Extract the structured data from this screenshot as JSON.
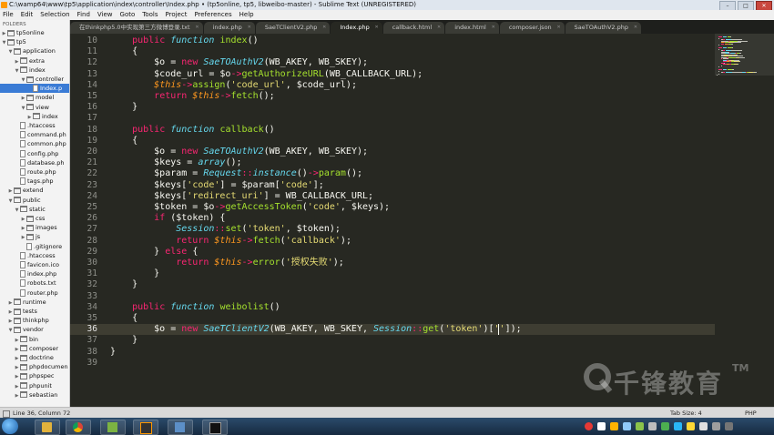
{
  "window": {
    "title": "C:\\wamp64\\www\\tp5\\application\\index\\controller\\Index.php • (tp5online, tp5, libweibo-master) - Sublime Text (UNREGISTERED)"
  },
  "menu": [
    "File",
    "Edit",
    "Selection",
    "Find",
    "View",
    "Goto",
    "Tools",
    "Project",
    "Preferences",
    "Help"
  ],
  "sidebar": {
    "header": "FOLDERS",
    "items": [
      {
        "label": "tp5online",
        "depth": 0,
        "type": "folder",
        "open": false
      },
      {
        "label": "tp5",
        "depth": 0,
        "type": "folder",
        "open": true
      },
      {
        "label": "application",
        "depth": 1,
        "type": "folder",
        "open": true
      },
      {
        "label": "extra",
        "depth": 2,
        "type": "folder",
        "open": false
      },
      {
        "label": "index",
        "depth": 2,
        "type": "folder",
        "open": true
      },
      {
        "label": "controller",
        "depth": 3,
        "type": "folder",
        "open": true
      },
      {
        "label": "Index.p",
        "depth": 4,
        "type": "file",
        "selected": true
      },
      {
        "label": "model",
        "depth": 3,
        "type": "folder",
        "open": false
      },
      {
        "label": "view",
        "depth": 3,
        "type": "folder",
        "open": true
      },
      {
        "label": "index",
        "depth": 4,
        "type": "folder",
        "open": false
      },
      {
        "label": ".htaccess",
        "depth": 2,
        "type": "file"
      },
      {
        "label": "command.ph",
        "depth": 2,
        "type": "file"
      },
      {
        "label": "common.php",
        "depth": 2,
        "type": "file"
      },
      {
        "label": "config.php",
        "depth": 2,
        "type": "file"
      },
      {
        "label": "database.ph",
        "depth": 2,
        "type": "file"
      },
      {
        "label": "route.php",
        "depth": 2,
        "type": "file"
      },
      {
        "label": "tags.php",
        "depth": 2,
        "type": "file"
      },
      {
        "label": "extend",
        "depth": 1,
        "type": "folder",
        "open": false
      },
      {
        "label": "public",
        "depth": 1,
        "type": "folder",
        "open": true
      },
      {
        "label": "static",
        "depth": 2,
        "type": "folder",
        "open": true
      },
      {
        "label": "css",
        "depth": 3,
        "type": "folder",
        "open": false
      },
      {
        "label": "images",
        "depth": 3,
        "type": "folder",
        "open": false
      },
      {
        "label": "js",
        "depth": 3,
        "type": "folder",
        "open": false
      },
      {
        "label": ".gitignore",
        "depth": 3,
        "type": "file"
      },
      {
        "label": ".htaccess",
        "depth": 2,
        "type": "file"
      },
      {
        "label": "favicon.ico",
        "depth": 2,
        "type": "file"
      },
      {
        "label": "index.php",
        "depth": 2,
        "type": "file"
      },
      {
        "label": "robots.txt",
        "depth": 2,
        "type": "file"
      },
      {
        "label": "router.php",
        "depth": 2,
        "type": "file"
      },
      {
        "label": "runtime",
        "depth": 1,
        "type": "folder",
        "open": false
      },
      {
        "label": "tests",
        "depth": 1,
        "type": "folder",
        "open": false
      },
      {
        "label": "thinkphp",
        "depth": 1,
        "type": "folder",
        "open": false
      },
      {
        "label": "vendor",
        "depth": 1,
        "type": "folder",
        "open": true
      },
      {
        "label": "bin",
        "depth": 2,
        "type": "folder",
        "open": false
      },
      {
        "label": "composer",
        "depth": 2,
        "type": "folder",
        "open": false
      },
      {
        "label": "doctrine",
        "depth": 2,
        "type": "folder",
        "open": false
      },
      {
        "label": "phpdocumen",
        "depth": 2,
        "type": "folder",
        "open": false
      },
      {
        "label": "phpspec",
        "depth": 2,
        "type": "folder",
        "open": false
      },
      {
        "label": "phpunit",
        "depth": 2,
        "type": "folder",
        "open": false
      },
      {
        "label": "sebastian",
        "depth": 2,
        "type": "folder",
        "open": false
      }
    ]
  },
  "tabs": [
    {
      "label": "在thinkphp5.0中实现第三方微博登录.txt",
      "active": false
    },
    {
      "label": "index.php",
      "active": false
    },
    {
      "label": "SaeTClientV2.php",
      "active": false
    },
    {
      "label": "Index.php",
      "active": true
    },
    {
      "label": "callback.html",
      "active": false
    },
    {
      "label": "index.html",
      "active": false
    },
    {
      "label": "composer.json",
      "active": false
    },
    {
      "label": "SaeTOAuthV2.php",
      "active": false
    }
  ],
  "editor": {
    "current_line": 36,
    "lines": [
      {
        "n": "10",
        "t": [
          [
            "    ",
            ""
          ],
          [
            "public",
            "kw"
          ],
          [
            " ",
            ""
          ],
          [
            "function",
            "sf"
          ],
          [
            " ",
            ""
          ],
          [
            "index",
            "fn"
          ],
          [
            "()",
            ""
          ]
        ]
      },
      {
        "n": "11",
        "t": [
          [
            "    {",
            ""
          ]
        ]
      },
      {
        "n": "12",
        "t": [
          [
            "        $o = ",
            ""
          ],
          [
            "new",
            "kw"
          ],
          [
            " ",
            ""
          ],
          [
            "SaeTOAuthV2",
            "cls"
          ],
          [
            "(WB_AKEY, WB_SKEY);",
            ""
          ]
        ]
      },
      {
        "n": "13",
        "t": [
          [
            "        $code_url = $o",
            ""
          ],
          [
            "->",
            "op"
          ],
          [
            "getAuthorizeURL",
            "fn"
          ],
          [
            "(WB_CALLBACK_URL);",
            ""
          ]
        ]
      },
      {
        "n": "14",
        "t": [
          [
            "        ",
            ""
          ],
          [
            "$this",
            "th"
          ],
          [
            "->",
            "op"
          ],
          [
            "assign",
            "fn"
          ],
          [
            "(",
            ""
          ],
          [
            "'code_url'",
            "st"
          ],
          [
            ", $code_url);",
            ""
          ]
        ]
      },
      {
        "n": "15",
        "t": [
          [
            "        ",
            ""
          ],
          [
            "return",
            "kw"
          ],
          [
            " ",
            ""
          ],
          [
            "$this",
            "th"
          ],
          [
            "->",
            "op"
          ],
          [
            "fetch",
            "fn"
          ],
          [
            "();",
            ""
          ]
        ]
      },
      {
        "n": "16",
        "t": [
          [
            "    }",
            ""
          ]
        ]
      },
      {
        "n": "17",
        "t": [
          [
            "",
            ""
          ]
        ]
      },
      {
        "n": "18",
        "t": [
          [
            "    ",
            ""
          ],
          [
            "public",
            "kw"
          ],
          [
            " ",
            ""
          ],
          [
            "function",
            "sf"
          ],
          [
            " ",
            ""
          ],
          [
            "callback",
            "fn"
          ],
          [
            "()",
            ""
          ]
        ]
      },
      {
        "n": "19",
        "t": [
          [
            "    {",
            ""
          ]
        ]
      },
      {
        "n": "20",
        "t": [
          [
            "        $o = ",
            ""
          ],
          [
            "new",
            "kw"
          ],
          [
            " ",
            ""
          ],
          [
            "SaeTOAuthV2",
            "cls"
          ],
          [
            "(WB_AKEY, WB_SKEY);",
            ""
          ]
        ]
      },
      {
        "n": "21",
        "t": [
          [
            "        $keys = ",
            ""
          ],
          [
            "array",
            "sf"
          ],
          [
            "();",
            ""
          ]
        ]
      },
      {
        "n": "22",
        "t": [
          [
            "        $param = ",
            ""
          ],
          [
            "Request",
            "cls"
          ],
          [
            "::",
            "op"
          ],
          [
            "instance",
            "sf"
          ],
          [
            "()",
            ""
          ],
          [
            "->",
            "op"
          ],
          [
            "param",
            "fn"
          ],
          [
            "();",
            ""
          ]
        ]
      },
      {
        "n": "23",
        "t": [
          [
            "        $keys[",
            ""
          ],
          [
            "'code'",
            "st"
          ],
          [
            "] = $param[",
            ""
          ],
          [
            "'code'",
            "st"
          ],
          [
            "];",
            ""
          ]
        ]
      },
      {
        "n": "24",
        "t": [
          [
            "        $keys[",
            ""
          ],
          [
            "'redirect_uri'",
            "st"
          ],
          [
            "] = WB_CALLBACK_URL;",
            ""
          ]
        ]
      },
      {
        "n": "25",
        "t": [
          [
            "        $token = $o",
            ""
          ],
          [
            "->",
            "op"
          ],
          [
            "getAccessToken",
            "fn"
          ],
          [
            "(",
            ""
          ],
          [
            "'code'",
            "st"
          ],
          [
            ", $keys);",
            ""
          ]
        ]
      },
      {
        "n": "26",
        "t": [
          [
            "        ",
            ""
          ],
          [
            "if",
            "kw"
          ],
          [
            " ($token) {",
            ""
          ]
        ]
      },
      {
        "n": "27",
        "t": [
          [
            "            ",
            ""
          ],
          [
            "Session",
            "cls"
          ],
          [
            "::",
            "op"
          ],
          [
            "set",
            "fn"
          ],
          [
            "(",
            ""
          ],
          [
            "'token'",
            "st"
          ],
          [
            ", $token);",
            ""
          ]
        ]
      },
      {
        "n": "28",
        "t": [
          [
            "            ",
            ""
          ],
          [
            "return",
            "kw"
          ],
          [
            " ",
            ""
          ],
          [
            "$this",
            "th"
          ],
          [
            "->",
            "op"
          ],
          [
            "fetch",
            "fn"
          ],
          [
            "(",
            ""
          ],
          [
            "'callback'",
            "st"
          ],
          [
            ");",
            ""
          ]
        ]
      },
      {
        "n": "29",
        "t": [
          [
            "        } ",
            ""
          ],
          [
            "else",
            "kw"
          ],
          [
            " {",
            ""
          ]
        ]
      },
      {
        "n": "30",
        "t": [
          [
            "            ",
            ""
          ],
          [
            "return",
            "kw"
          ],
          [
            " ",
            ""
          ],
          [
            "$this",
            "th"
          ],
          [
            "->",
            "op"
          ],
          [
            "error",
            "fn"
          ],
          [
            "(",
            ""
          ],
          [
            "'授权失败'",
            "st"
          ],
          [
            ");",
            ""
          ]
        ]
      },
      {
        "n": "31",
        "t": [
          [
            "        }",
            ""
          ]
        ]
      },
      {
        "n": "32",
        "t": [
          [
            "    }",
            ""
          ]
        ]
      },
      {
        "n": "33",
        "t": [
          [
            "",
            ""
          ]
        ]
      },
      {
        "n": "34",
        "t": [
          [
            "    ",
            ""
          ],
          [
            "public",
            "kw"
          ],
          [
            " ",
            ""
          ],
          [
            "function",
            "sf"
          ],
          [
            " ",
            ""
          ],
          [
            "weibolist",
            "fn"
          ],
          [
            "()",
            ""
          ]
        ]
      },
      {
        "n": "35",
        "t": [
          [
            "    {",
            ""
          ]
        ]
      },
      {
        "n": "36",
        "t": [
          [
            "        $o = ",
            ""
          ],
          [
            "new",
            "kw"
          ],
          [
            " ",
            ""
          ],
          [
            "SaeTClientV2",
            "cls"
          ],
          [
            "(WB_AKEY, WB_SKEY, ",
            ""
          ],
          [
            "Session",
            "cls"
          ],
          [
            "::",
            "op"
          ],
          [
            "get",
            "fn"
          ],
          [
            "(",
            ""
          ],
          [
            "'token'",
            "st"
          ],
          [
            ")[",
            ""
          ],
          [
            "''",
            "st"
          ],
          [
            "]);",
            ""
          ]
        ]
      },
      {
        "n": "37",
        "t": [
          [
            "    }",
            ""
          ]
        ]
      },
      {
        "n": "38",
        "t": [
          [
            "}",
            ""
          ]
        ]
      },
      {
        "n": "39",
        "t": [
          [
            "",
            ""
          ]
        ]
      }
    ]
  },
  "watermark": {
    "text": "千锋教育",
    "tm": "TM"
  },
  "status": {
    "position": "Line 36, Column 72",
    "tab_size": "Tab Size: 4",
    "syntax": "PHP"
  },
  "colors": {
    "accent": "#3a7bd5",
    "editor_bg": "#272822",
    "keyword": "#f92672",
    "function": "#a6e22e",
    "string": "#e6db74",
    "storage": "#66d9ef"
  }
}
